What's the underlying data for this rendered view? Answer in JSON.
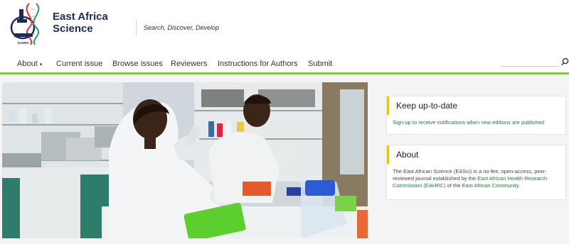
{
  "site": {
    "title_line1": "East Africa",
    "title_line2": "Science",
    "tagline": "Search, Discover, Develop",
    "logo_text": "EAHRC"
  },
  "nav": {
    "items": [
      {
        "label": "About",
        "has_dropdown": true
      },
      {
        "label": "Current issue"
      },
      {
        "label": "Browse issues"
      },
      {
        "label": "Reviewers"
      },
      {
        "label": "Instructions for Authors"
      },
      {
        "label": "Submit"
      }
    ],
    "dropdown_caret": "▾"
  },
  "sidebar": {
    "keep_up": {
      "title": "Keep up-to-date",
      "link": "Sign-up to receive notifications when new editions are published"
    },
    "about": {
      "title": "About",
      "text_1": "The East African Science (EASci) is a no-fee, open-access, peer-reviewed journal established by the ",
      "link_1": "East African Health Research Commission (EAHRC)",
      "text_2": " of the ",
      "link_2": "East African Community",
      "text_3": "."
    }
  },
  "colors": {
    "brand": "#1d2a5e",
    "nav_accent": "#8bc34a",
    "block_accent": "#e4c41a",
    "link": "#1f7a3a"
  },
  "icons": {
    "search": "search-icon"
  }
}
